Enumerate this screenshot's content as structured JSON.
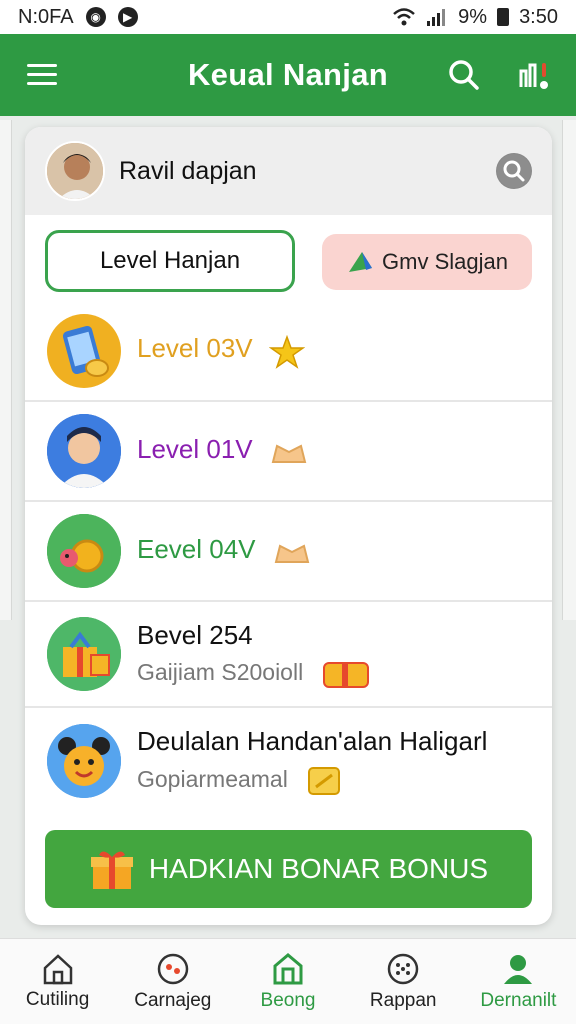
{
  "status_bar": {
    "left_text": "N:0FA",
    "battery": "9%",
    "time": "3:50"
  },
  "app_bar": {
    "title": "Keual Nanjan",
    "icons": [
      "menu-icon",
      "search-icon",
      "notification-icon"
    ]
  },
  "profile": {
    "username": "Ravil dapjan"
  },
  "tabs": {
    "active": "Level Hanjan",
    "other": "Gmv Slagjan"
  },
  "rows": [
    {
      "title": "Level 03V",
      "title_color": "#e0a020",
      "icon": "phone-coins-icon"
    },
    {
      "title": "Level 01V",
      "title_color": "#8a1fb0",
      "icon": "boy-avatar-icon"
    },
    {
      "title": "Eevel 04V",
      "title_color": "#2e9a43",
      "icon": "coin-bird-icon"
    },
    {
      "title": "Bevel 254",
      "subtitle": "Gaijiam S20oioll",
      "title_color": "#111111",
      "icon": "gift-box-icon"
    },
    {
      "title": "Deulalan Handan'alan Haligarl",
      "subtitle": "Gopiarmeamal",
      "title_color": "#111111",
      "icon": "mascot-icon"
    }
  ],
  "cta": {
    "label": "HADKIAN BONAR BONUS"
  },
  "bottom_nav": [
    {
      "label": "Cutiling",
      "icon": "home-icon"
    },
    {
      "label": "Carnajeg",
      "icon": "game-icon"
    },
    {
      "label": "Beong",
      "icon": "store-icon",
      "active": true
    },
    {
      "label": "Rappan",
      "icon": "dots-icon"
    },
    {
      "label": "Dernanilt",
      "icon": "person-icon",
      "active": true
    }
  ],
  "colors": {
    "primary_green": "#2e9a43",
    "cta_green": "#43a63f",
    "tab_pink": "#fad4d0"
  }
}
